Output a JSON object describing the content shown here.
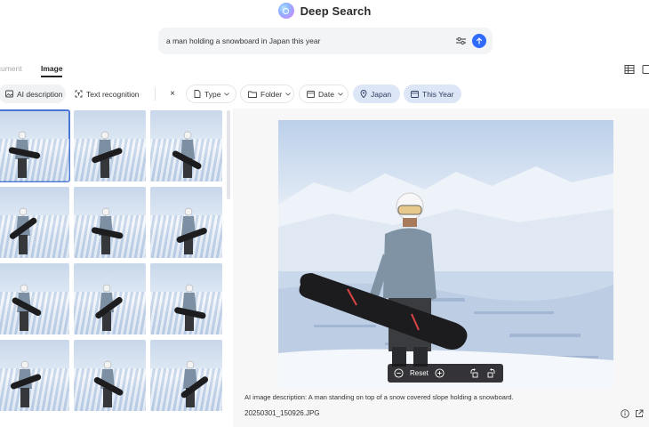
{
  "app": {
    "title": "Deep Search"
  },
  "search": {
    "value": "a man holding a snowboard in Japan this year",
    "placeholder": ""
  },
  "tabs": [
    {
      "label": "ocument"
    },
    {
      "label": "Image"
    }
  ],
  "filters": {
    "ai_description": "AI description",
    "text_recognition": "Text recognition",
    "clear": "×",
    "type": "Type",
    "folder": "Folder",
    "date": "Date",
    "location": "Japan",
    "time": "This Year"
  },
  "results": {
    "count_visible": 12,
    "selected_index": 0
  },
  "preview": {
    "reset_label": "Reset",
    "description": "AI image description: A man standing on top of a snow covered slope holding a snowboard.",
    "filename": "20250301_150926.JPG"
  },
  "icons": [
    "search-logo",
    "sliders-icon",
    "arrow-up-icon",
    "table-view-icon",
    "grid-view-icon",
    "image-icon",
    "text-icon",
    "file-icon",
    "folder-icon",
    "calendar-icon",
    "pin-icon",
    "zoom-out-icon",
    "zoom-in-icon",
    "rotate-left-icon",
    "rotate-right-icon",
    "info-icon",
    "external-link-icon"
  ],
  "colors": {
    "accent": "#2f6bff",
    "chip_active": "#dde6f7",
    "selection": "#4a77d6"
  }
}
